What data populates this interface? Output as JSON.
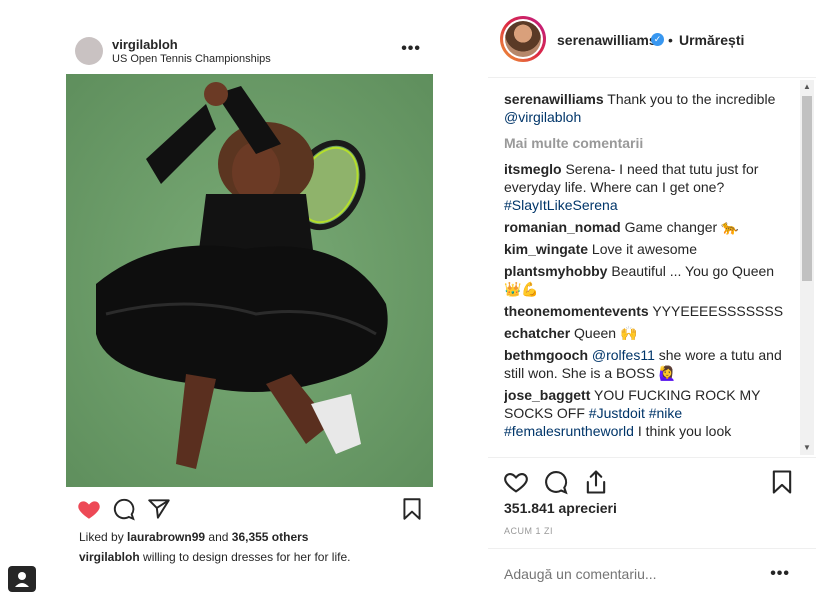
{
  "left_post": {
    "username": "virgilabloh",
    "location": "US Open Tennis Championships",
    "more_label": "•••",
    "liked_by_prefix": "Liked by ",
    "liked_by_user": "laurabrown99",
    "liked_by_and": " and ",
    "liked_by_others": "36,355 others",
    "caption_user": "virgilabloh",
    "caption_text": " willing to design dresses for her for life.",
    "liked": true
  },
  "right_panel": {
    "username": "serenawilliams",
    "verified_mark": "✓",
    "separator": "•",
    "follow_label": "Urmărești",
    "caption_user": "serenawilliams",
    "caption_text": " Thank you to the incredible ",
    "caption_link": "@virgilabloh",
    "more_comments_label": "Mai multe comentarii",
    "comments": [
      {
        "user": "itsmeglo",
        "text": " Serena- I need that tutu just for everyday life. Where can I get one? ",
        "link": "#SlayItLikeSerena",
        "rest": ""
      },
      {
        "user": "romanian_nomad",
        "text": " Game changer 🐆",
        "link": "",
        "rest": ""
      },
      {
        "user": "kim_wingate",
        "text": " Love it awesome",
        "link": "",
        "rest": ""
      },
      {
        "user": "plantsmyhobby",
        "text": " Beautiful ... You go Queen 👑💪",
        "link": "",
        "rest": ""
      },
      {
        "user": "theonemomentevents",
        "text": " YYYEEEESSSSSSS",
        "link": "",
        "rest": ""
      },
      {
        "user": "echatcher",
        "text": " Queen 🙌",
        "link": "",
        "rest": ""
      },
      {
        "user": "bethmgooch",
        "text": " ",
        "link": "@rolfes11",
        "rest": " she wore a tutu and still won. She is a BOSS 🙋‍♀"
      },
      {
        "user": "jose_baggett",
        "text": " YOU FUCKING ROCK MY SOCKS OFF ",
        "link": "#Justdoit #nike #femalesruntheworld",
        "rest": " I think you look"
      }
    ],
    "likes_label": "351.841 aprecieri",
    "time_label": "ACUM 1 ZI",
    "add_comment_placeholder": "Adaugă un comentariu...",
    "add_more_label": "•••"
  },
  "colors": {
    "heart": "#ed4956",
    "link": "#003569",
    "muted": "#999999",
    "verified": "#3897f0"
  }
}
